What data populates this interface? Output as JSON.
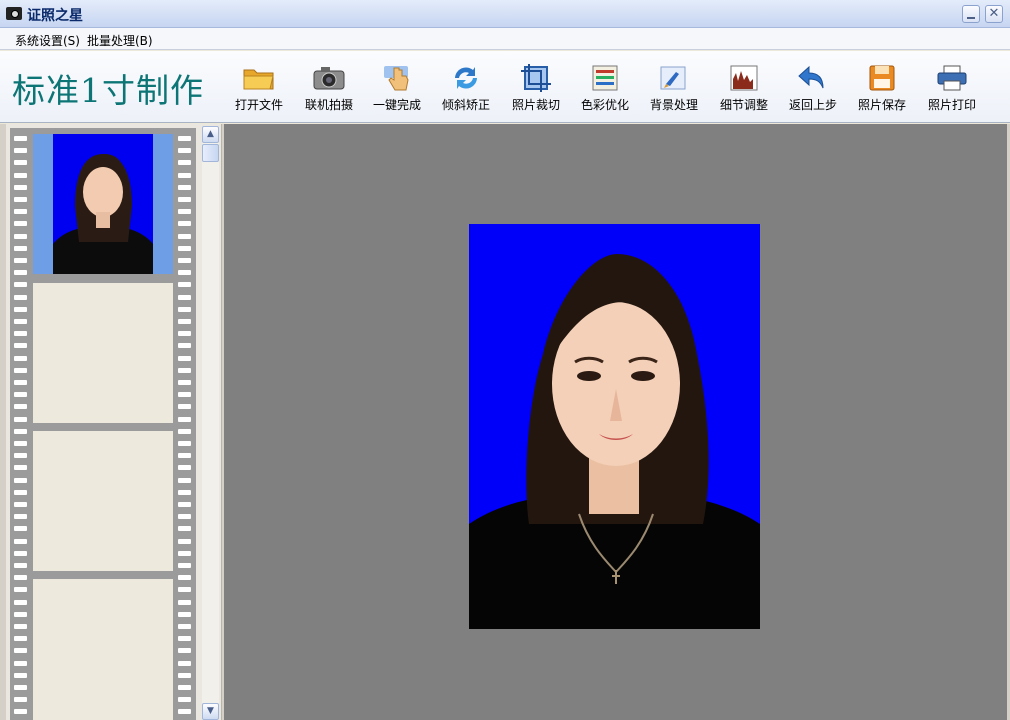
{
  "window": {
    "title": "证照之星",
    "close_glyph": "✕"
  },
  "menu": {
    "system": "系统设置(S)",
    "batch": "批量处理(B)"
  },
  "toolbar": {
    "mode_title": "标准1寸制作",
    "buttons": [
      {
        "label": "打开文件",
        "icon": "folder-icon"
      },
      {
        "label": "联机拍摄",
        "icon": "camera-icon"
      },
      {
        "label": "一键完成",
        "icon": "hand-pointer-icon"
      },
      {
        "label": "倾斜矫正",
        "icon": "rotate-icon"
      },
      {
        "label": "照片裁切",
        "icon": "crop-icon"
      },
      {
        "label": "色彩优化",
        "icon": "color-bars-icon"
      },
      {
        "label": "背景处理",
        "icon": "brush-icon"
      },
      {
        "label": "细节调整",
        "icon": "histogram-icon"
      },
      {
        "label": "返回上步",
        "icon": "undo-arrow-icon"
      },
      {
        "label": "照片保存",
        "icon": "floppy-save-icon"
      },
      {
        "label": "照片打印",
        "icon": "printer-icon"
      }
    ]
  },
  "filmstrip": {
    "frames": [
      "photo",
      "empty",
      "empty",
      "empty"
    ],
    "selected_index": 0
  },
  "colors": {
    "photo_background": "#0000fa",
    "canvas": "#808080",
    "title_teal": "#0d7575",
    "selected_frame": "#6d9ee6"
  }
}
